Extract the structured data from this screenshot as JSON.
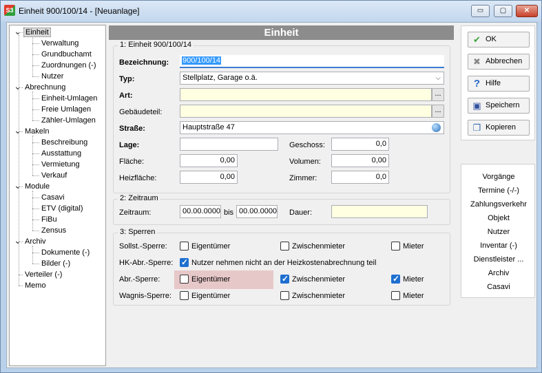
{
  "window": {
    "title": "Einheit 900/100/14 - [Neuanlage]",
    "app_icon_text": "S3",
    "minimize": "▭",
    "maximize": "▢",
    "close": "✕"
  },
  "tree": {
    "items": [
      {
        "label": "Einheit",
        "level": 0,
        "expanded": true,
        "selected": true
      },
      {
        "label": "Verwaltung",
        "level": 1
      },
      {
        "label": "Grundbuchamt",
        "level": 1
      },
      {
        "label": "Zuordnungen (-)",
        "level": 1
      },
      {
        "label": "Nutzer",
        "level": 1
      },
      {
        "label": "Abrechnung",
        "level": 0,
        "expanded": true
      },
      {
        "label": "Einheit-Umlagen",
        "level": 1
      },
      {
        "label": "Freie Umlagen",
        "level": 1
      },
      {
        "label": "Zähler-Umlagen",
        "level": 1
      },
      {
        "label": "Makeln",
        "level": 0,
        "expanded": true
      },
      {
        "label": "Beschreibung",
        "level": 1
      },
      {
        "label": "Ausstattung",
        "level": 1
      },
      {
        "label": "Vermietung",
        "level": 1
      },
      {
        "label": "Verkauf",
        "level": 1
      },
      {
        "label": "Module",
        "level": 0,
        "expanded": true
      },
      {
        "label": "Casavi",
        "level": 1
      },
      {
        "label": "ETV (digital)",
        "level": 1
      },
      {
        "label": "FiBu",
        "level": 1
      },
      {
        "label": "Zensus",
        "level": 1
      },
      {
        "label": "Archiv",
        "level": 0,
        "expanded": true
      },
      {
        "label": "Dokumente (-)",
        "level": 1
      },
      {
        "label": "Bilder (-)",
        "level": 1
      },
      {
        "label": "Verteiler (-)",
        "level": 0
      },
      {
        "label": "Memo",
        "level": 0
      }
    ]
  },
  "header": {
    "title": "Einheit"
  },
  "group1": {
    "label": "1: Einheit 900/100/14",
    "bezeichnung_label": "Bezeichnung:",
    "bezeichnung_value": "900/100/14",
    "typ_label": "Typ:",
    "typ_value": "Stellplatz, Garage o.ä.",
    "art_label": "Art:",
    "art_value": "",
    "gebaeudeteil_label": "Gebäudeteil:",
    "gebaeudeteil_value": "",
    "strasse_label": "Straße:",
    "strasse_value": "Hauptstraße 47",
    "lage_label": "Lage:",
    "lage_value": "",
    "geschoss_label": "Geschoss:",
    "geschoss_value": "0,0",
    "flaeche_label": "Fläche:",
    "flaeche_value": "0,00",
    "volumen_label": "Volumen:",
    "volumen_value": "0,00",
    "heizflaeche_label": "Heizfläche:",
    "heizflaeche_value": "0,00",
    "zimmer_label": "Zimmer:",
    "zimmer_value": "0,0",
    "ellipsis": "..."
  },
  "group2": {
    "label": "2: Zeitraum",
    "zeitraum_label": "Zeitraum:",
    "von_value": "00.00.0000",
    "bis_label": "bis",
    "bis_value": "00.00.0000",
    "dauer_label": "Dauer:",
    "dauer_value": ""
  },
  "group3": {
    "label": "3: Sperren",
    "rows": [
      {
        "label": "Sollst.-Sperre:",
        "c1": "Eigentümer",
        "c1_checked": false,
        "c2": "Zwischenmieter",
        "c2_checked": false,
        "c3": "Mieter",
        "c3_checked": false
      },
      {
        "label": "HK-Abr.-Sperre:",
        "c1": "Nutzer nehmen nicht an der Heizkostenabrechnung teil",
        "c1_checked": true
      },
      {
        "label": "Abr.-Sperre:",
        "c1": "Eigentümer",
        "c1_checked": false,
        "c2": "Zwischenmieter",
        "c2_checked": true,
        "c3": "Mieter",
        "c3_checked": true
      },
      {
        "label": "Wagnis-Sperre:",
        "c1": "Eigentümer",
        "c1_checked": false,
        "c2": "Zwischenmieter",
        "c2_checked": false,
        "c3": "Mieter",
        "c3_checked": false
      }
    ]
  },
  "buttons": {
    "ok": "OK",
    "abbrechen": "Abbrechen",
    "hilfe": "Hilfe",
    "speichern": "Speichern",
    "kopieren": "Kopieren"
  },
  "links": [
    "Vorgänge",
    "Termine (-/-)",
    "Zahlungsverkehr",
    "Objekt",
    "Nutzer",
    "Inventar (-)",
    "Dienstleister ...",
    "Archiv",
    "Casavi"
  ]
}
